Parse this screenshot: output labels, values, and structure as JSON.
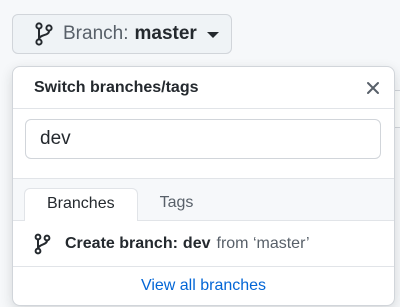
{
  "branch_button": {
    "label": "Branch:",
    "branch_name": "master",
    "icon": "git-branch-icon"
  },
  "dropdown": {
    "title": "Switch branches/tags",
    "close_icon": "close-icon",
    "filter": {
      "value": "dev",
      "placeholder": ""
    },
    "tabs": [
      {
        "label": "Branches",
        "selected": true
      },
      {
        "label": "Tags",
        "selected": false
      }
    ],
    "create_branch": {
      "prefix": "Create branch:",
      "branch": "dev",
      "from_text": "from ‘master’",
      "icon": "git-branch-icon"
    },
    "view_all_link": "View all branches"
  },
  "colors": {
    "accent": "#0366d6",
    "text": "#24292e",
    "muted": "#586069",
    "border": "#d1d5da"
  }
}
